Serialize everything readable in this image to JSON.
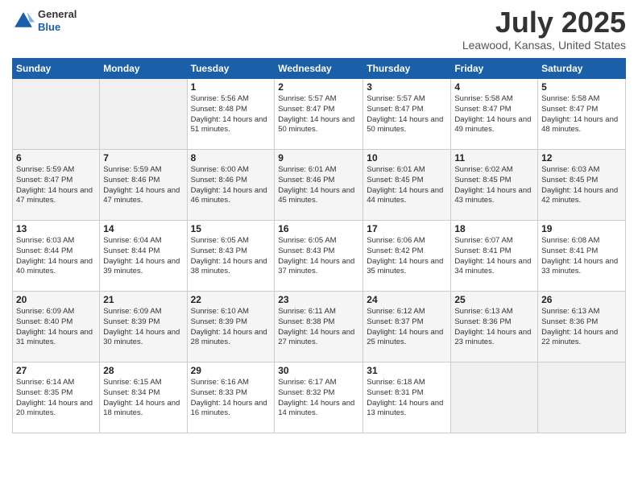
{
  "logo": {
    "general": "General",
    "blue": "Blue"
  },
  "title": "July 2025",
  "location": "Leawood, Kansas, United States",
  "weekdays": [
    "Sunday",
    "Monday",
    "Tuesday",
    "Wednesday",
    "Thursday",
    "Friday",
    "Saturday"
  ],
  "weeks": [
    [
      {
        "day": "",
        "empty": true
      },
      {
        "day": "",
        "empty": true
      },
      {
        "day": "1",
        "sunrise": "5:56 AM",
        "sunset": "8:48 PM",
        "daylight": "14 hours and 51 minutes."
      },
      {
        "day": "2",
        "sunrise": "5:57 AM",
        "sunset": "8:47 PM",
        "daylight": "14 hours and 50 minutes."
      },
      {
        "day": "3",
        "sunrise": "5:57 AM",
        "sunset": "8:47 PM",
        "daylight": "14 hours and 50 minutes."
      },
      {
        "day": "4",
        "sunrise": "5:58 AM",
        "sunset": "8:47 PM",
        "daylight": "14 hours and 49 minutes."
      },
      {
        "day": "5",
        "sunrise": "5:58 AM",
        "sunset": "8:47 PM",
        "daylight": "14 hours and 48 minutes."
      }
    ],
    [
      {
        "day": "6",
        "sunrise": "5:59 AM",
        "sunset": "8:47 PM",
        "daylight": "14 hours and 47 minutes."
      },
      {
        "day": "7",
        "sunrise": "5:59 AM",
        "sunset": "8:46 PM",
        "daylight": "14 hours and 47 minutes."
      },
      {
        "day": "8",
        "sunrise": "6:00 AM",
        "sunset": "8:46 PM",
        "daylight": "14 hours and 46 minutes."
      },
      {
        "day": "9",
        "sunrise": "6:01 AM",
        "sunset": "8:46 PM",
        "daylight": "14 hours and 45 minutes."
      },
      {
        "day": "10",
        "sunrise": "6:01 AM",
        "sunset": "8:45 PM",
        "daylight": "14 hours and 44 minutes."
      },
      {
        "day": "11",
        "sunrise": "6:02 AM",
        "sunset": "8:45 PM",
        "daylight": "14 hours and 43 minutes."
      },
      {
        "day": "12",
        "sunrise": "6:03 AM",
        "sunset": "8:45 PM",
        "daylight": "14 hours and 42 minutes."
      }
    ],
    [
      {
        "day": "13",
        "sunrise": "6:03 AM",
        "sunset": "8:44 PM",
        "daylight": "14 hours and 40 minutes."
      },
      {
        "day": "14",
        "sunrise": "6:04 AM",
        "sunset": "8:44 PM",
        "daylight": "14 hours and 39 minutes."
      },
      {
        "day": "15",
        "sunrise": "6:05 AM",
        "sunset": "8:43 PM",
        "daylight": "14 hours and 38 minutes."
      },
      {
        "day": "16",
        "sunrise": "6:05 AM",
        "sunset": "8:43 PM",
        "daylight": "14 hours and 37 minutes."
      },
      {
        "day": "17",
        "sunrise": "6:06 AM",
        "sunset": "8:42 PM",
        "daylight": "14 hours and 35 minutes."
      },
      {
        "day": "18",
        "sunrise": "6:07 AM",
        "sunset": "8:41 PM",
        "daylight": "14 hours and 34 minutes."
      },
      {
        "day": "19",
        "sunrise": "6:08 AM",
        "sunset": "8:41 PM",
        "daylight": "14 hours and 33 minutes."
      }
    ],
    [
      {
        "day": "20",
        "sunrise": "6:09 AM",
        "sunset": "8:40 PM",
        "daylight": "14 hours and 31 minutes."
      },
      {
        "day": "21",
        "sunrise": "6:09 AM",
        "sunset": "8:39 PM",
        "daylight": "14 hours and 30 minutes."
      },
      {
        "day": "22",
        "sunrise": "6:10 AM",
        "sunset": "8:39 PM",
        "daylight": "14 hours and 28 minutes."
      },
      {
        "day": "23",
        "sunrise": "6:11 AM",
        "sunset": "8:38 PM",
        "daylight": "14 hours and 27 minutes."
      },
      {
        "day": "24",
        "sunrise": "6:12 AM",
        "sunset": "8:37 PM",
        "daylight": "14 hours and 25 minutes."
      },
      {
        "day": "25",
        "sunrise": "6:13 AM",
        "sunset": "8:36 PM",
        "daylight": "14 hours and 23 minutes."
      },
      {
        "day": "26",
        "sunrise": "6:13 AM",
        "sunset": "8:36 PM",
        "daylight": "14 hours and 22 minutes."
      }
    ],
    [
      {
        "day": "27",
        "sunrise": "6:14 AM",
        "sunset": "8:35 PM",
        "daylight": "14 hours and 20 minutes."
      },
      {
        "day": "28",
        "sunrise": "6:15 AM",
        "sunset": "8:34 PM",
        "daylight": "14 hours and 18 minutes."
      },
      {
        "day": "29",
        "sunrise": "6:16 AM",
        "sunset": "8:33 PM",
        "daylight": "14 hours and 16 minutes."
      },
      {
        "day": "30",
        "sunrise": "6:17 AM",
        "sunset": "8:32 PM",
        "daylight": "14 hours and 14 minutes."
      },
      {
        "day": "31",
        "sunrise": "6:18 AM",
        "sunset": "8:31 PM",
        "daylight": "14 hours and 13 minutes."
      },
      {
        "day": "",
        "empty": true
      },
      {
        "day": "",
        "empty": true
      }
    ]
  ],
  "colors": {
    "header_bg": "#1a5fa8",
    "header_text": "#ffffff",
    "odd_row": "#f9f9f9",
    "even_row": "#ffffff",
    "empty_cell": "#f0f0f0"
  }
}
